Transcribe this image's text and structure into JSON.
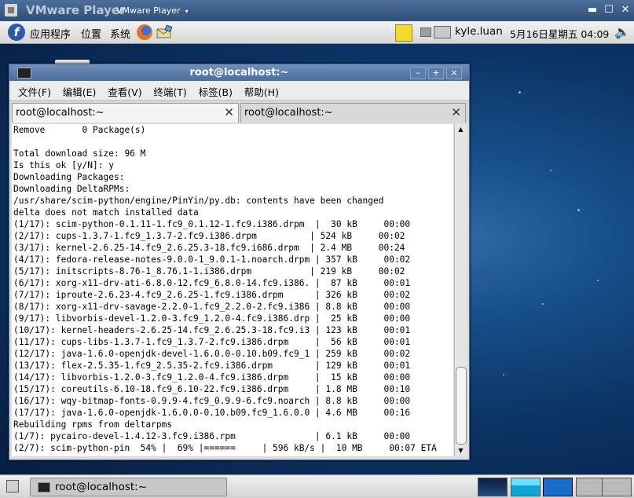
{
  "vmware": {
    "title": "VMware Player",
    "menu_label": "VMware Player",
    "menu_arrow": "▾",
    "minimize": "▬",
    "restore": "☐",
    "close": "✕"
  },
  "top_panel": {
    "logo_letter": "f",
    "menus": [
      "应用程序",
      "位置",
      "系统"
    ],
    "username": "kyle.luan",
    "clock": "5月16日星期五  04:09",
    "volume_glyph": "🔈"
  },
  "terminal": {
    "title": "root@localhost:~",
    "btn_min": "–",
    "btn_max": "+",
    "btn_close": "×",
    "menu": [
      "文件(F)",
      "编辑(E)",
      "查看(V)",
      "终端(T)",
      "标签(B)",
      "帮助(H)"
    ],
    "tabs": [
      {
        "label": "root@localhost:~",
        "close": "✕"
      },
      {
        "label": "root@localhost:~",
        "close": "✕"
      }
    ],
    "lines": [
      "Remove       0 Package(s)",
      "",
      "Total download size: 96 M",
      "Is this ok [y/N]: y",
      "Downloading Packages:",
      "Downloading DeltaRPMs:",
      "/usr/share/scim-python/engine/PinYin/py.db: contents have been changed",
      "delta does not match installed data",
      "(1/17): scim-python-0.1.11-1.fc9_0.1.12-1.fc9.i386.drpm  |  30 kB     00:00",
      "(2/17): cups-1.3.7-1.fc9_1.3.7-2.fc9.i386.drpm          | 524 kB     00:02",
      "(3/17): kernel-2.6.25-14.fc9_2.6.25.3-18.fc9.i686.drpm  | 2.4 MB     00:24",
      "(4/17): fedora-release-notes-9.0.0-1_9.0.1-1.noarch.drpm | 357 kB     00:02",
      "(5/17): initscripts-8.76-1_8.76.1-1.i386.drpm           | 219 kB     00:02",
      "(6/17): xorg-x11-drv-ati-6.8.0-12.fc9_6.8.0-14.fc9.i386. |  87 kB     00:01",
      "(7/17): iproute-2.6.23-4.fc9_2.6.25-1.fc9.i386.drpm      | 326 kB     00:02",
      "(8/17): xorg-x11-drv-savage-2.2.0-1.fc9_2.2.0-2.fc9.i386 | 8.8 kB     00:00",
      "(9/17): libvorbis-devel-1.2.0-3.fc9_1.2.0-4.fc9.i386.drp |  25 kB     00:00",
      "(10/17): kernel-headers-2.6.25-14.fc9_2.6.25.3-18.fc9.i3 | 123 kB     00:01",
      "(11/17): cups-libs-1.3.7-1.fc9_1.3.7-2.fc9.i386.drpm     |  56 kB     00:01",
      "(12/17): java-1.6.0-openjdk-devel-1.6.0.0-0.10.b09.fc9_1 | 259 kB     00:02",
      "(13/17): flex-2.5.35-1.fc9_2.5.35-2.fc9.i386.drpm        | 129 kB     00:01",
      "(14/17): libvorbis-1.2.0-3.fc9_1.2.0-4.fc9.i386.drpm     |  15 kB     00:00",
      "(15/17): coreutils-6.10-18.fc9_6.10-22.fc9.i386.drpm     | 1.8 MB     00:10",
      "(16/17): wqy-bitmap-fonts-0.9.9-4.fc9_0.9.9-6.fc9.noarch | 8.8 kB     00:00",
      "(17/17): java-1.6.0-openjdk-1.6.0.0-0.10.b09.fc9_1.6.0.0 | 4.6 MB     00:16",
      "Rebuilding rpms from deltarpms",
      "(1/7): pycairo-devel-1.4.12-3.fc9.i386.rpm               | 6.1 kB     00:00",
      "(2/7): scim-python-pin  54% |  69% |======     | 596 kB/s |  10 MB     00:07 ETA"
    ]
  },
  "bottom_panel": {
    "task_label": "root@localhost:~"
  }
}
